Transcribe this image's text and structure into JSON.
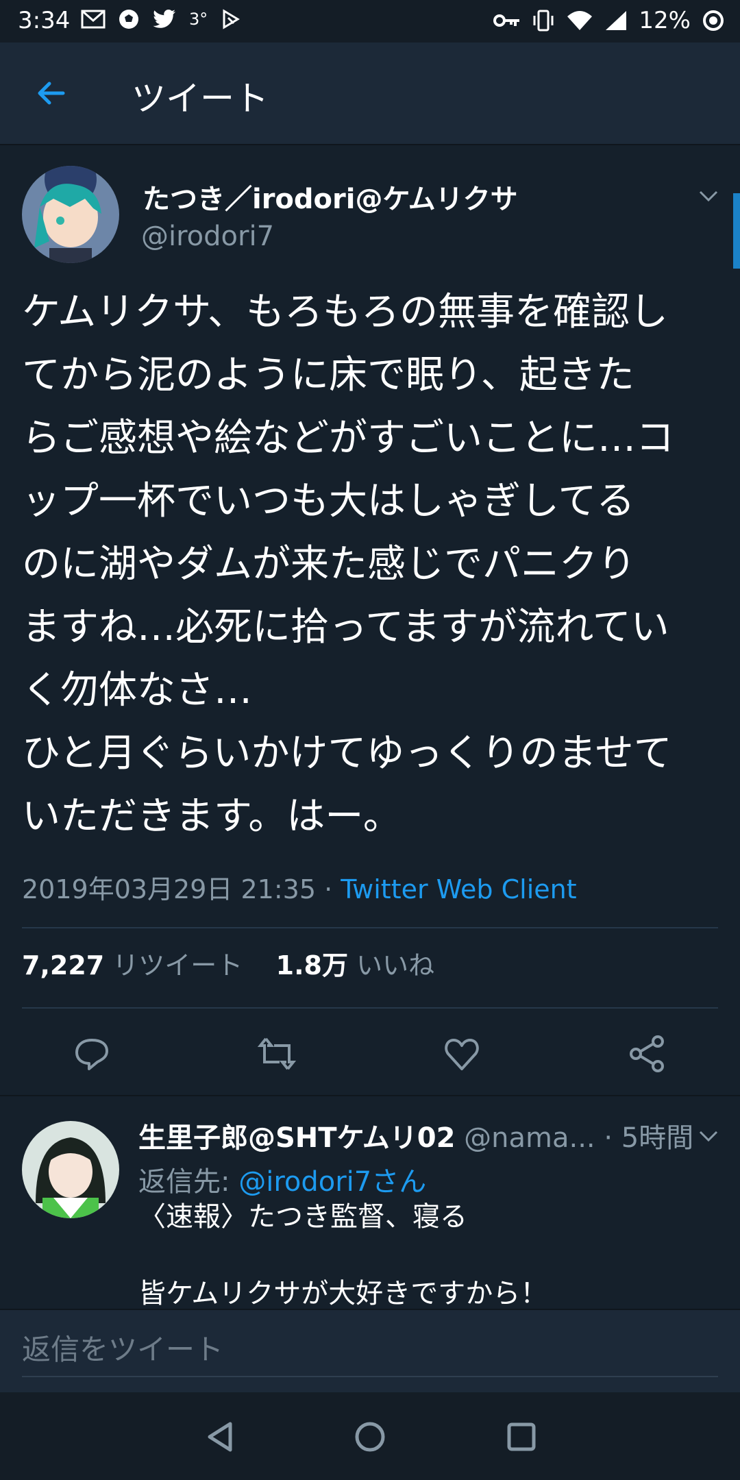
{
  "status_bar": {
    "time": "3:34",
    "signal_label": "3°",
    "battery": "12%"
  },
  "app_bar": {
    "title": "ツイート"
  },
  "tweet": {
    "display_name": "たつき／irodori@ケムリクサ",
    "handle": "@irodori7",
    "text": "ケムリクサ、もろもろの無事を確認し\nてから泥のように床で眠り、起きた\nらご感想や絵などがすごいことに…コ\nップ一杯でいつも大はしゃぎしてる\nのに湖やダムが来た感じでパニクり\nますね…必死に拾ってますが流れてい\nく勿体なさ…\nひと月ぐらいかけてゆっくりのませて\nいただきます。はー。",
    "timestamp": "2019年03月29日 21:35 · ",
    "client": "Twitter Web Client",
    "retweet_count": "7,227",
    "retweet_label": "リツイート",
    "like_count": "1.8万",
    "like_label": "いいね"
  },
  "reply": {
    "display_name": "生里子郎@SHTケムリ02",
    "handle": "@nama...",
    "time": "· 5時間",
    "reply_to_prefix": "返信先: ",
    "reply_to_user": "@irodori7さん",
    "text": "〈速報〉たつき監督、寝る\n\n皆ケムリクサが大好きですから！"
  },
  "composer": {
    "placeholder": "返信をツイート"
  },
  "colors": {
    "background": "#15202b",
    "accent": "#1d9bf0",
    "secondary_text": "#8899a6"
  }
}
